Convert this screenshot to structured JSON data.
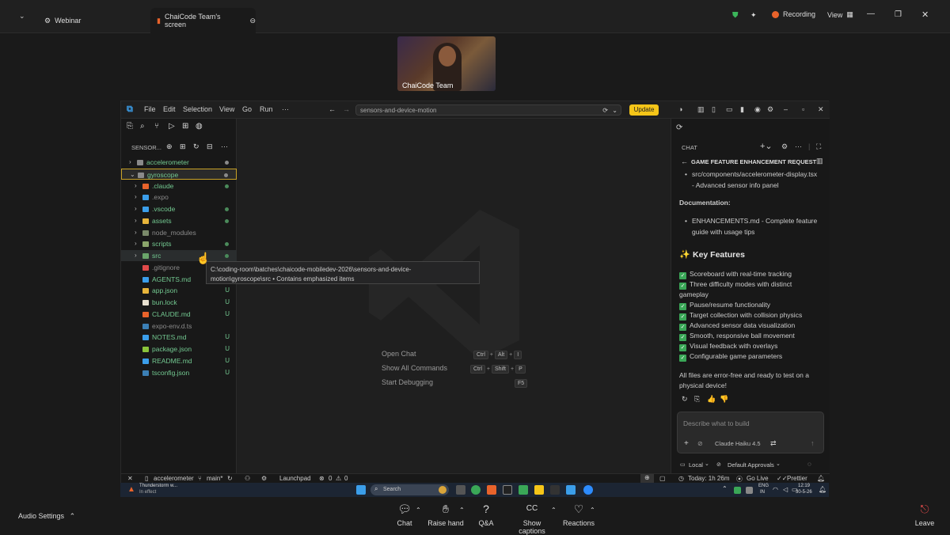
{
  "zoom": {
    "tabs": [
      {
        "label": "Webinar"
      },
      {
        "label": "ChaiCode Team's screen"
      }
    ],
    "recording_label": "Recording",
    "view_label": "View",
    "participant_name": "ChaiCode Team",
    "bottom": {
      "audio_settings": "Audio Settings",
      "chat": "Chat",
      "raise_hand": "Raise hand",
      "qa": "Q&A",
      "show_captions": "Show captions",
      "reactions": "Reactions",
      "leave": "Leave"
    }
  },
  "vscode": {
    "menus": [
      "File",
      "Edit",
      "Selection",
      "View",
      "Go",
      "Run",
      "···"
    ],
    "search_text": "sensors-and-device-motion",
    "update_label": "Update",
    "explorer_title": "SENSOR...",
    "tree": [
      {
        "label": "accelerometer",
        "type": "folder",
        "expanded": false,
        "status": "dot"
      },
      {
        "label": "gyroscope",
        "type": "folder",
        "expanded": true,
        "status": "dot"
      },
      {
        "label": ".claude",
        "type": "folder",
        "status": "dot"
      },
      {
        "label": ".expo",
        "type": "folder",
        "status": ""
      },
      {
        "label": ".vscode",
        "type": "folder",
        "status": "dot"
      },
      {
        "label": "assets",
        "type": "folder",
        "status": "dot"
      },
      {
        "label": "node_modules",
        "type": "folder",
        "status": ""
      },
      {
        "label": "scripts",
        "type": "folder",
        "status": "dot"
      },
      {
        "label": "src",
        "type": "folder",
        "status": "dot"
      },
      {
        "label": ".gitignore",
        "type": "file",
        "status": ""
      },
      {
        "label": "AGENTS.md",
        "type": "file",
        "status": "U"
      },
      {
        "label": "app.json",
        "type": "file",
        "status": "U"
      },
      {
        "label": "bun.lock",
        "type": "file",
        "status": "U"
      },
      {
        "label": "CLAUDE.md",
        "type": "file",
        "status": "U"
      },
      {
        "label": "expo-env.d.ts",
        "type": "file",
        "status": ""
      },
      {
        "label": "NOTES.md",
        "type": "file",
        "status": "U"
      },
      {
        "label": "package.json",
        "type": "file",
        "status": "U"
      },
      {
        "label": "README.md",
        "type": "file",
        "status": "U"
      },
      {
        "label": "tsconfig.json",
        "type": "file",
        "status": "U"
      }
    ],
    "tooltip_line1": "C:\\coding-room\\batches\\chaicode-mobiledev-2026\\sensors-and-device-",
    "tooltip_line2": "motion\\gyroscope\\src • Contains emphasized items",
    "commands": [
      {
        "label": "Open Chat",
        "keys": [
          "Ctrl",
          "Alt",
          "I"
        ]
      },
      {
        "label": "Show All Commands",
        "keys": [
          "Ctrl",
          "Shift",
          "P"
        ]
      },
      {
        "label": "Start Debugging",
        "keys": [
          "F5"
        ]
      }
    ],
    "chat": {
      "header": "CHAT",
      "request_title": "GAME FEATURE ENHANCEMENT REQUEST",
      "file_bullet_1": "src/components/accelerometer-display.tsx",
      "file_bullet_2": "- Advanced sensor info panel",
      "documentation_label": "Documentation:",
      "doc_bullet_1": "ENHANCEMENTS.md - Complete feature",
      "doc_bullet_2": "guide with usage tips",
      "key_features_title": "Key Features",
      "features": [
        "Scoreboard with real-time tracking",
        "Three difficulty modes with distinct",
        "Pause/resume functionality",
        "Target collection with collision physics",
        "Advanced sensor data visualization",
        "Smooth, responsive ball movement",
        "Visual feedback with overlays",
        "Configurable game parameters"
      ],
      "feature_wrap": "gameplay",
      "summary_1": "All files are error-free and ready to test on a",
      "summary_2": "physical device!",
      "input_placeholder": "Describe what to build",
      "model": "Claude Haiku 4.5",
      "local": "Local",
      "approvals": "Default Approvals"
    },
    "status": {
      "device": "accelerometer",
      "branch": "main*",
      "launchpad": "Launchpad",
      "errors": "0",
      "warnings": "0",
      "today": "Today: 1h 26m",
      "golive": "Go Live",
      "prettier": "Prettier"
    }
  },
  "taskbar": {
    "weather_title": "Thunderstorm w...",
    "weather_sub": "In effect",
    "search": "Search",
    "lang_1": "ENG",
    "lang_2": "IN",
    "time": "12:19",
    "date": "30-5-26"
  }
}
